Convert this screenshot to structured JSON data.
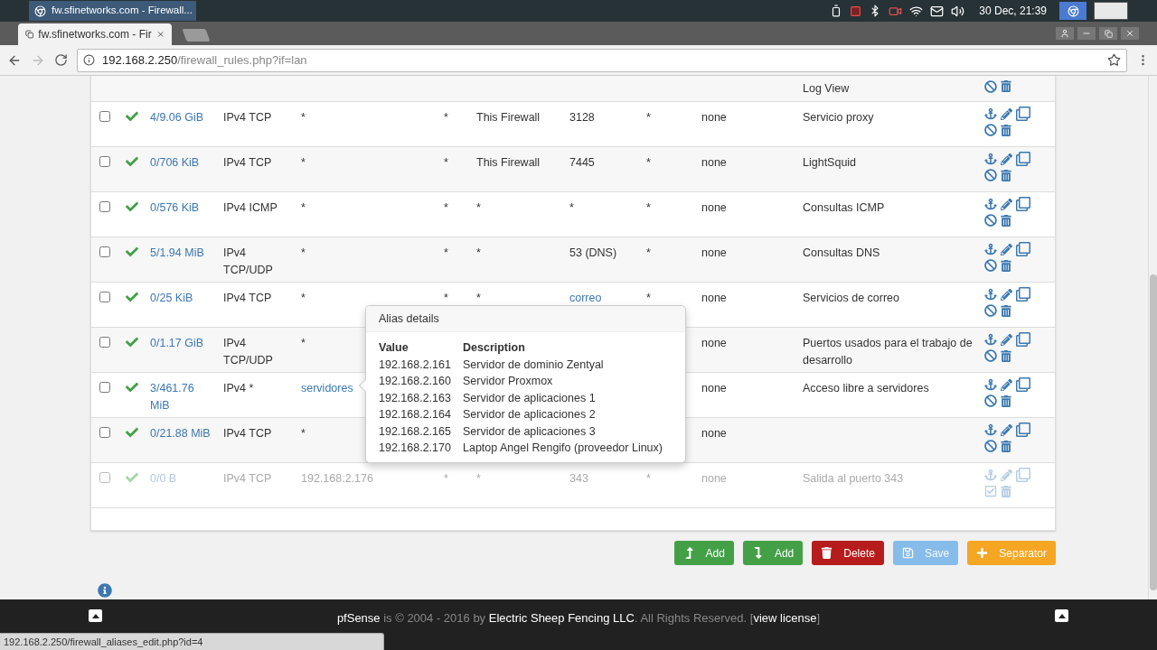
{
  "taskbar": {
    "window_button": "fw.sfinetworks.com - Firewall...",
    "clock": "30 Dec, 21:39"
  },
  "browser": {
    "tab_title": "fw.sfinetworks.com - Fir",
    "url_host": "192.168.2.250",
    "url_path": "/firewall_rules.php?if=lan"
  },
  "top_row_fragment": {
    "description": "Log View"
  },
  "rules": [
    {
      "states": "4/9.06 GiB",
      "protocol": "IPv4 TCP",
      "source": "*",
      "source_port": "*",
      "destination": "This Firewall",
      "destination_port": "3128",
      "gateway": "*",
      "queue": "none",
      "description": "Servicio proxy",
      "source_link": false,
      "port_link": false,
      "disabled": false
    },
    {
      "states": "0/706 KiB",
      "protocol": "IPv4 TCP",
      "source": "*",
      "source_port": "*",
      "destination": "This Firewall",
      "destination_port": "7445",
      "gateway": "*",
      "queue": "none",
      "description": "LightSquid",
      "source_link": false,
      "port_link": false,
      "disabled": false
    },
    {
      "states": "0/576 KiB",
      "protocol": "IPv4 ICMP",
      "source": "*",
      "source_port": "*",
      "destination": "*",
      "destination_port": "*",
      "gateway": "*",
      "queue": "none",
      "description": "Consultas ICMP",
      "source_link": false,
      "port_link": false,
      "disabled": false
    },
    {
      "states": "5/1.94 MiB",
      "protocol": "IPv4 TCP/UDP",
      "source": "*",
      "source_port": "*",
      "destination": "*",
      "destination_port": "53 (DNS)",
      "gateway": "*",
      "queue": "none",
      "description": "Consultas DNS",
      "source_link": false,
      "port_link": false,
      "disabled": false
    },
    {
      "states": "0/25 KiB",
      "protocol": "IPv4 TCP",
      "source": "*",
      "source_port": "*",
      "destination": "*",
      "destination_port": "correo",
      "gateway": "*",
      "queue": "none",
      "description": "Servicios de correo",
      "source_link": false,
      "port_link": true,
      "disabled": false
    },
    {
      "states": "0/1.17 GiB",
      "protocol": "IPv4 TCP/UDP",
      "source": "*",
      "queue": "none",
      "description": "Puertos usados para el trabajo de desarrollo",
      "source_link": false,
      "disabled": false
    },
    {
      "states": "3/461.76 MiB",
      "protocol": "IPv4 *",
      "source": "servidores",
      "queue": "none",
      "description": "Acceso libre a servidores",
      "source_link": true,
      "disabled": false
    },
    {
      "states": "0/21.88 MiB",
      "protocol": "IPv4 TCP",
      "source": "*",
      "queue": "none",
      "source_link": false,
      "disabled": false
    },
    {
      "states": "0/0 B",
      "protocol": "IPv4 TCP",
      "source": "192.168.2.176",
      "source_port": "*",
      "destination": "*",
      "destination_port": "343",
      "gateway": "*",
      "queue": "none",
      "description": "Salida al puerto 343",
      "source_link": false,
      "port_link": false,
      "disabled": true
    }
  ],
  "alias_popover": {
    "title": "Alias details",
    "columns": [
      "Value",
      "Description"
    ],
    "rows": [
      [
        "192.168.2.161",
        "Servidor de dominio Zentyal"
      ],
      [
        "192.168.2.160",
        "Servidor Proxmox"
      ],
      [
        "192.168.2.163",
        "Servidor de aplicaciones 1"
      ],
      [
        "192.168.2.164",
        "Servidor de aplicaciones 2"
      ],
      [
        "192.168.2.165",
        "Servidor de aplicaciones 3"
      ],
      [
        "192.168.2.170",
        "Laptop Angel Rengifo (proveedor Linux)"
      ]
    ]
  },
  "buttons": [
    {
      "label": "Add",
      "kind": "add_top",
      "disabled": false
    },
    {
      "label": "Add",
      "kind": "add_bottom",
      "disabled": false
    },
    {
      "label": "Delete",
      "kind": "delete",
      "disabled": false
    },
    {
      "label": "Save",
      "kind": "save",
      "disabled": true
    },
    {
      "label": "Separator",
      "kind": "separator",
      "disabled": false
    }
  ],
  "footer": {
    "text": "**pfSense** is © 2004 - 2016 by **Electric Sheep Fencing LLC**. All Rights Reserved. [",
    "link": "view license",
    "close": "]"
  },
  "status_url": "192.168.2.250/firewall_aliases_edit.php?id=4"
}
